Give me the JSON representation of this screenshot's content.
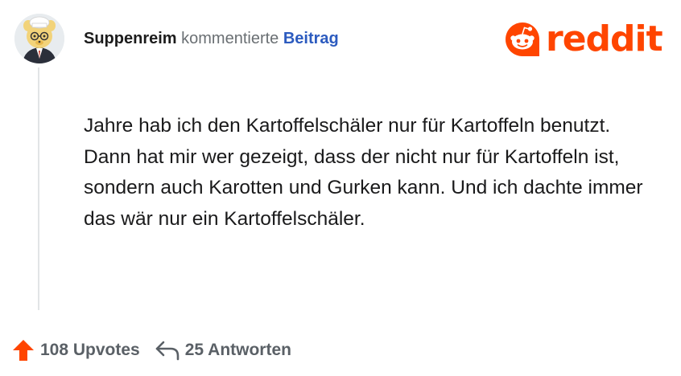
{
  "comment": {
    "username": "Suppenreim",
    "action_text": "kommentierte",
    "post_link_label": "Beitrag",
    "body": "Jahre hab ich den Kartoffelschäler nur für Kartoffeln benutzt. Dann hat mir wer gezeigt, dass der nicht nur für Kartoffeln ist, sondern auch Karotten und Gurken kann. Und ich dachte immer das wär nur ein Kartoffelschäler."
  },
  "brand": {
    "wordmark": "reddit",
    "color": "#ff4500"
  },
  "footer": {
    "upvotes_label": "108 Upvotes",
    "replies_label": "25 Antworten"
  },
  "icons": {
    "upvote": "upvote-arrow-icon",
    "reply": "reply-arrow-icon",
    "logo": "reddit-snoo-icon"
  }
}
